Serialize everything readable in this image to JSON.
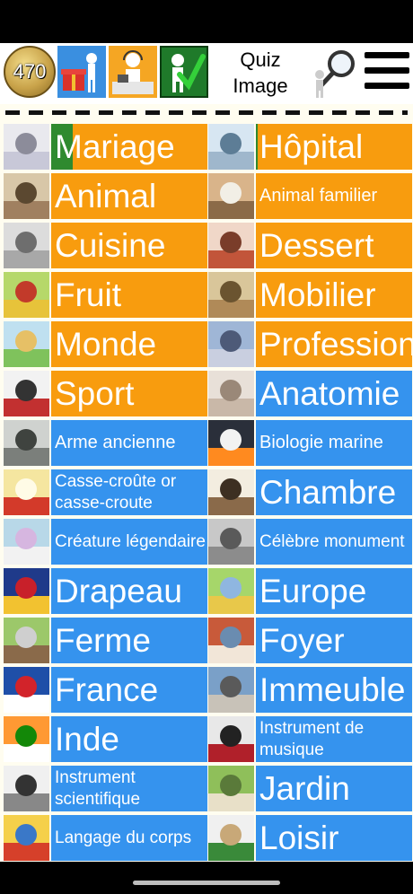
{
  "header": {
    "coins": "470",
    "title_line1": "Quiz",
    "title_line2": "Image",
    "icons": [
      "coin-badge-icon",
      "gift-shop-icon",
      "support-person-icon",
      "checkmark-person-icon",
      "magnifier-person-icon",
      "hamburger-menu-icon"
    ]
  },
  "colors": {
    "orange": "#f89c0e",
    "blue": "#3593ee",
    "green": "#2f8a2f",
    "background": "#fffdf0"
  },
  "categories": [
    {
      "label": "Mariage",
      "style": "orange",
      "size": "big",
      "progress": 0.14
    },
    {
      "label": "Hôpital",
      "style": "orange",
      "size": "big",
      "progress": 0.01
    },
    {
      "label": "Animal",
      "style": "orange",
      "size": "big"
    },
    {
      "label": "Animal familier",
      "style": "orange",
      "size": "mid"
    },
    {
      "label": "Cuisine",
      "style": "orange",
      "size": "big"
    },
    {
      "label": "Dessert",
      "style": "orange",
      "size": "big"
    },
    {
      "label": "Fruit",
      "style": "orange",
      "size": "big"
    },
    {
      "label": "Mobilier",
      "style": "orange",
      "size": "big"
    },
    {
      "label": "Monde",
      "style": "orange",
      "size": "big"
    },
    {
      "label": "Profession",
      "style": "orange",
      "size": "big"
    },
    {
      "label": "Sport",
      "style": "orange",
      "size": "big"
    },
    {
      "label": "Anatomie",
      "style": "blue",
      "size": "big"
    },
    {
      "label": "Arme ancienne",
      "style": "blue",
      "size": "mid"
    },
    {
      "label": "Biologie marine",
      "style": "blue",
      "size": "mid"
    },
    {
      "label": "Casse-croûte or casse-croute",
      "style": "blue",
      "size": "small"
    },
    {
      "label": "Chambre",
      "style": "blue",
      "size": "big"
    },
    {
      "label": "Créature légendaire",
      "style": "blue",
      "size": "small"
    },
    {
      "label": "Célèbre monument",
      "style": "blue",
      "size": "small"
    },
    {
      "label": "Drapeau",
      "style": "blue",
      "size": "big"
    },
    {
      "label": "Europe",
      "style": "blue",
      "size": "big"
    },
    {
      "label": "Ferme",
      "style": "blue",
      "size": "big"
    },
    {
      "label": "Foyer",
      "style": "blue",
      "size": "big"
    },
    {
      "label": "France",
      "style": "blue",
      "size": "big"
    },
    {
      "label": "Immeuble",
      "style": "blue",
      "size": "big"
    },
    {
      "label": "Inde",
      "style": "blue",
      "size": "big"
    },
    {
      "label": "Instrument de musique",
      "style": "blue",
      "size": "small"
    },
    {
      "label": "Instrument scientifique",
      "style": "blue",
      "size": "small"
    },
    {
      "label": "Jardin",
      "style": "blue",
      "size": "big"
    },
    {
      "label": "Langage du corps",
      "style": "blue",
      "size": "small"
    },
    {
      "label": "Loisir",
      "style": "blue",
      "size": "big"
    }
  ]
}
